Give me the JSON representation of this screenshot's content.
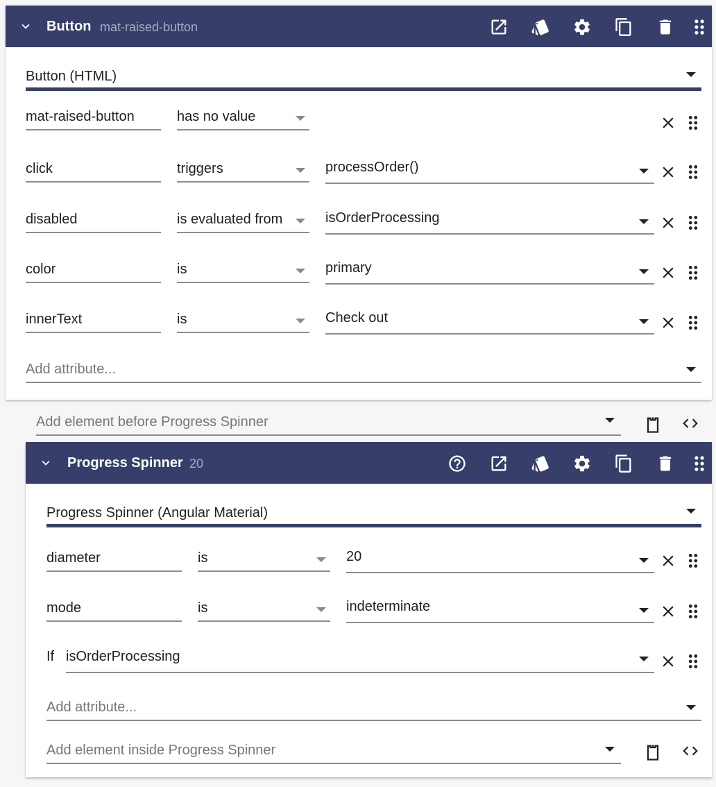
{
  "colors": {
    "header_bg": "#363e69",
    "header_sub": "#a6abc2",
    "page_bg": "#f6f6f6"
  },
  "button_block": {
    "title": "Button",
    "subtitle": "mat-raised-button",
    "header_icons": [
      "open-in-new-icon",
      "style-icon",
      "settings-icon",
      "copy-icon",
      "delete-icon",
      "drag-handle-icon"
    ],
    "element_type": "Button (HTML)",
    "attributes": [
      {
        "name": "mat-raised-button",
        "operator": "has no value",
        "value": null
      },
      {
        "name": "click",
        "operator": "triggers",
        "value": "processOrder()"
      },
      {
        "name": "disabled",
        "operator": "is evaluated from",
        "value": "isOrderProcessing"
      },
      {
        "name": "color",
        "operator": "is",
        "value": "primary"
      },
      {
        "name": "innerText",
        "operator": "is",
        "value": "Check out"
      }
    ],
    "add_attribute_placeholder": "Add attribute..."
  },
  "add_before": {
    "placeholder": "Add element before Progress Spinner"
  },
  "spinner_block": {
    "title": "Progress Spinner",
    "subtitle": "20",
    "header_icons": [
      "help-icon",
      "open-in-new-icon",
      "style-icon",
      "settings-icon",
      "copy-icon",
      "delete-icon",
      "drag-handle-icon"
    ],
    "element_type": "Progress Spinner (Angular Material)",
    "attributes": [
      {
        "name": "diameter",
        "operator": "is",
        "value": "20"
      },
      {
        "name": "mode",
        "operator": "is",
        "value": "indeterminate"
      }
    ],
    "condition": {
      "label": "If",
      "value": "isOrderProcessing"
    },
    "add_attribute_placeholder": "Add attribute...",
    "add_inside_placeholder": "Add element inside Progress Spinner"
  }
}
